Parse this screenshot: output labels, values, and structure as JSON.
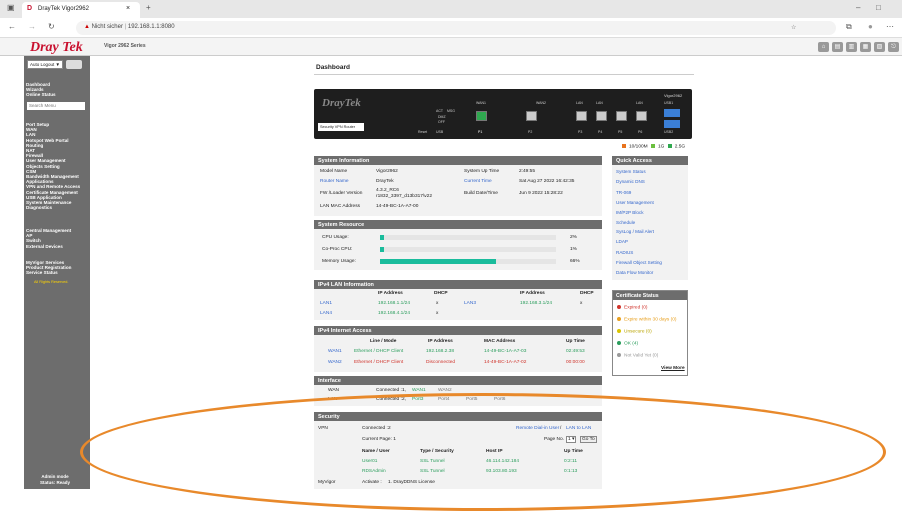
{
  "browser": {
    "tab_title": "DrayTek Vigor2962",
    "close": "×",
    "new_tab": "+",
    "security": "Nicht sicher",
    "url": "192.168.1.1:8080",
    "minimize": "–",
    "maximize": "□"
  },
  "header": {
    "logo": "Dray Tek",
    "model": "Vigor 2962 Series"
  },
  "sidebar": {
    "auto_logout": "Auto Logout ▼",
    "search_placeholder": "Search Menu",
    "group1": [
      "Dashboard",
      "Wizards",
      "Online Status"
    ],
    "group2": [
      "Port Setup",
      "WAN",
      "LAN",
      "Hotspot Web Portal",
      "Routing",
      "NAT",
      "Firewall",
      "User Management",
      "Objects Setting",
      "CSM",
      "Bandwidth Management",
      "Applications",
      "VPN and Remote Access",
      "Certificate Management",
      "USB Application",
      "System Maintenance",
      "Diagnostics"
    ],
    "group3": [
      "Central Management",
      "AP",
      "Switch",
      "External Devices"
    ],
    "group4": [
      "MyVigor Services",
      "Product Registration",
      "Service Status"
    ],
    "copyright": "All Rights Reserved.",
    "admin_mode": "Admin mode",
    "status": "Status: Ready"
  },
  "main": {
    "title": "Dashboard",
    "device": {
      "logo": "DrayTek",
      "model": "Vigor2962",
      "label": "Security VPN Router",
      "leds": [
        "ACT",
        "MSG",
        "DMZ",
        "OFF"
      ],
      "usb": "USB",
      "reset": "Reset",
      "port_groups": [
        "WAN1",
        "WAN2",
        "LAN",
        "LAN",
        "LAN",
        "USB1",
        "USB2"
      ],
      "ports": [
        "P1",
        "P2",
        "P3",
        "P4",
        "P5",
        "P6"
      ]
    },
    "legend": [
      "10/100M",
      "1G",
      "2.5G"
    ],
    "legend_colors": [
      "#e8731d",
      "#6bbf3f",
      "#2fa84f"
    ]
  },
  "system_info": {
    "title": "System Information",
    "rows": [
      [
        "Model Name",
        "Vigor2962",
        "System Up Time",
        "2:49:55"
      ],
      [
        "Router Name",
        "DrayTek",
        "Current Time",
        "Sat Aug 27 2022 16:42:35"
      ],
      [
        "FW /Loader Version",
        "4.3.2_RC6 r1832_3397_d13b317\\v22",
        "Build Date/Time",
        "Jun 9 2022 15:28:22"
      ],
      [
        "LAN MAC Address",
        "14-49-BC-1A-A7-00",
        "",
        ""
      ]
    ]
  },
  "system_resource": {
    "title": "System Resource",
    "rows": [
      {
        "label": "CPU Usage:",
        "value": "2%",
        "level": 2
      },
      {
        "label": "Co-Proc CPU:",
        "value": "1%",
        "level": 2
      },
      {
        "label": "Memory Usage:",
        "value": "66%",
        "level": 66
      }
    ]
  },
  "ipv4_lan": {
    "title": "IPv4 LAN Information",
    "headers": [
      "IP Address",
      "DHCP",
      "IP Address",
      "DHCP"
    ],
    "rows": [
      [
        "LAN1",
        "192.168.1.1/24",
        "x",
        "LAN3",
        "192.168.3.1/24",
        "x"
      ],
      [
        "LAN4",
        "192.168.4.1/24",
        "x",
        "",
        "",
        ""
      ]
    ]
  },
  "ipv4_internet": {
    "title": "IPv4 Internet Access",
    "headers": [
      "Line / Mode",
      "IP Address",
      "MAC Address",
      "Up Time"
    ],
    "rows": [
      [
        "WAN1",
        "Ethernet / DHCP Client",
        "192.168.2.38",
        "14-49-BC-1A-A7-03",
        "02:49:53"
      ],
      [
        "WAN2",
        "Ethernet / DHCP Client",
        "Disconnected",
        "14-49-BC-1A-A7-02",
        "00:00:00"
      ]
    ]
  },
  "interface": {
    "title": "Interface",
    "wan_label": "WAN",
    "wan_connected": "Connected :",
    "wan_count": "1,",
    "wan_items": [
      "WAN1",
      "WAN2"
    ],
    "lan_label": "LAN",
    "lan_connected": "Connected :",
    "lan_count": "2,",
    "lan_items": [
      "Port3",
      "Port4",
      "Port5",
      "Port6"
    ]
  },
  "security": {
    "title": "Security",
    "vpn_label": "VPN",
    "connected": "Connected :",
    "connected_count": "2",
    "link_dialin": "Remote Dial-in User",
    "link_sep": "/",
    "link_lan2lan": "LAN to LAN",
    "current_page": "Current Page: 1",
    "page_no": "Page No.",
    "page_select": "1 ▾",
    "go": "Go To",
    "headers": [
      "Name / User",
      "Type / Security",
      "Host IP",
      "Up Time"
    ],
    "rows": [
      [
        "User01",
        "SSL Tunnel",
        "46.114.142.184",
        "0:2:11"
      ],
      [
        "RDSAdmin",
        "SSL Tunnel",
        "93.103.80.193",
        "0:1:13"
      ]
    ],
    "myvigor_label": "MyVigor",
    "activate": "Activate :",
    "activate_value": "1. DrayDDNS License"
  },
  "quick_access": {
    "title": "Quick Access",
    "links": [
      "System Status",
      "Dynamic DNS",
      "TR-069",
      "User Management",
      "IM/P2P Block",
      "Schedule",
      "SysLog / Mail Alert",
      "LDAP",
      "RADIUS",
      "Firewall Object Setting",
      "Data Flow Monitor"
    ]
  },
  "certificate_status": {
    "title": "Certificate Status",
    "items": [
      {
        "label": "Expired (0)",
        "color": "#d0342c"
      },
      {
        "label": "Expire within 30 days (0)",
        "color": "#e8a020"
      },
      {
        "label": "Unsecure (0)",
        "color": "#d9c400"
      },
      {
        "label": "OK (4)",
        "color": "#2a9d5c"
      },
      {
        "label": "Not Valid Yet (0)",
        "color": "#9a9a9a"
      }
    ],
    "view_more": "View More"
  },
  "overlay": {
    "color": "#e8892b"
  }
}
